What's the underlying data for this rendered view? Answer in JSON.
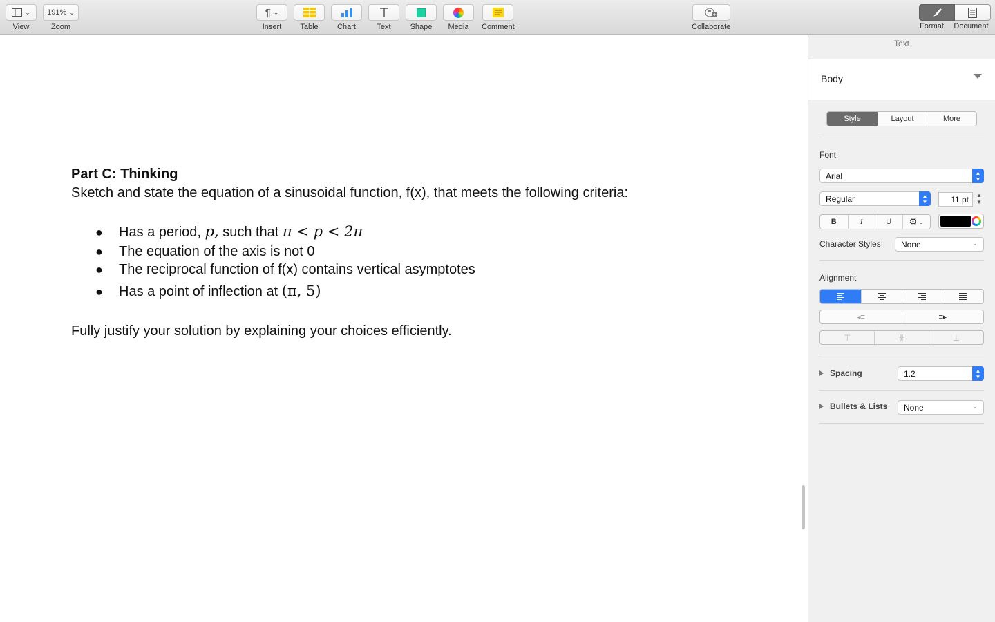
{
  "toolbar": {
    "view_label": "View",
    "zoom_value": "191%",
    "zoom_label": "Zoom",
    "insert_label": "Insert",
    "table_label": "Table",
    "chart_label": "Chart",
    "text_label": "Text",
    "shape_label": "Shape",
    "media_label": "Media",
    "comment_label": "Comment",
    "collaborate_label": "Collaborate",
    "format_label": "Format",
    "document_label": "Document"
  },
  "document": {
    "heading": "Part C: Thinking",
    "intro": "Sketch and state the equation of a sinusoidal function, f(x), that meets the following criteria:",
    "bullets": {
      "b1_text_a": "Has a period, ",
      "b1_math_a": "p,",
      "b1_text_b": " such that ",
      "b1_math_b": "π < p < 2π",
      "b2": "The equation of the axis is not 0",
      "b3": "The reciprocal function of f(x) contains vertical asymptotes",
      "b4_text": "Has a point of inflection at ",
      "b4_math": "(π,  5)",
      "marker": "●"
    },
    "closing": "Fully justify your solution by explaining your choices efficiently."
  },
  "inspector": {
    "title": "Text",
    "paragraph_style": "Body",
    "tabs": {
      "style": "Style",
      "layout": "Layout",
      "more": "More"
    },
    "font_label": "Font",
    "font_family": "Arial",
    "font_typeface": "Regular",
    "font_size": "11 pt",
    "bold_label": "B",
    "italic_label": "I",
    "underline_label": "U",
    "text_color": "#000000",
    "character_styles_label": "Character Styles",
    "character_styles_value": "None",
    "alignment_label": "Alignment",
    "spacing_label": "Spacing",
    "spacing_value": "1.2",
    "bullets_label": "Bullets & Lists",
    "bullets_value": "None"
  },
  "colors": {
    "accent": "#2f7cf6",
    "toolbar_active": "#6e6e6e"
  },
  "icons": {
    "view": "sidebar-icon",
    "insert": "pilcrow-icon",
    "table": "table-icon",
    "chart": "bar-chart-icon",
    "text": "text-icon",
    "shape": "square-icon",
    "media": "flower-icon",
    "comment": "note-icon",
    "collaborate": "person-add-icon",
    "format": "paintbrush-icon",
    "document": "document-icon"
  }
}
